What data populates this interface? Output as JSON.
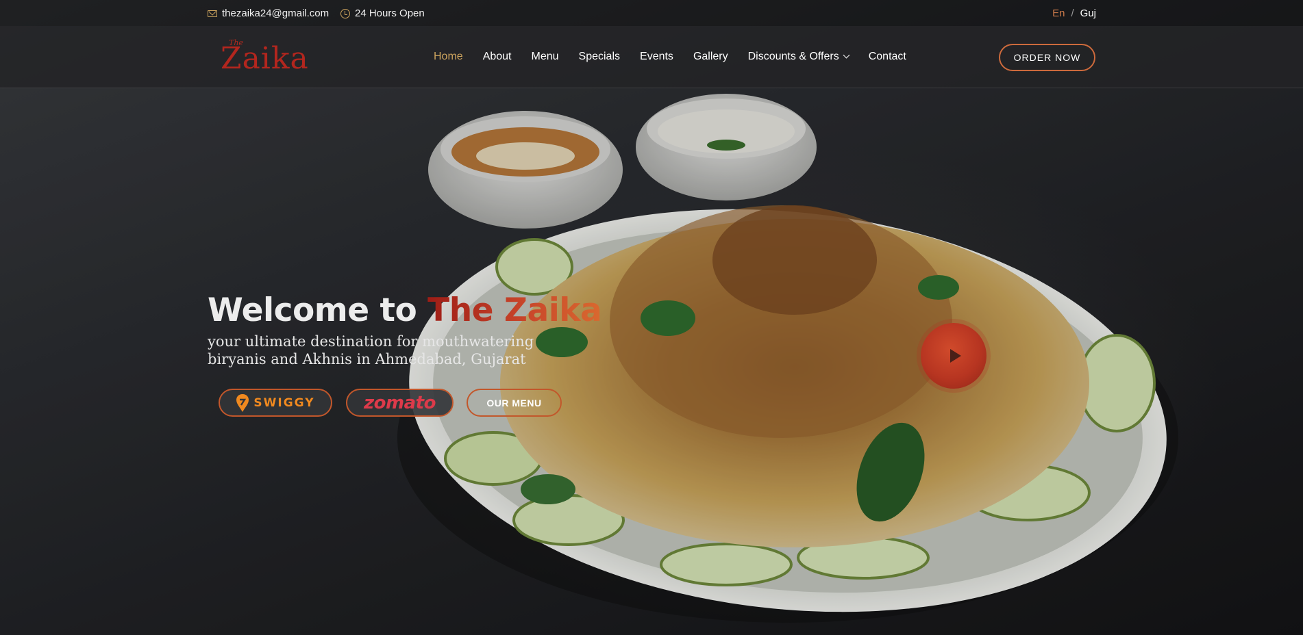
{
  "topbar": {
    "email": "thezaika24@gmail.com",
    "hours": "24 Hours Open",
    "lang_active": "En",
    "lang_separator": "/",
    "lang_other": "Guj"
  },
  "header": {
    "logo_small": "The",
    "logo_name": "Zaika",
    "nav": [
      {
        "label": "Home",
        "active": true
      },
      {
        "label": "About"
      },
      {
        "label": "Menu"
      },
      {
        "label": "Specials"
      },
      {
        "label": "Events"
      },
      {
        "label": "Gallery"
      },
      {
        "label": "Discounts & Offers",
        "dropdown": true
      },
      {
        "label": "Contact"
      }
    ],
    "order_button": "ORDER NOW"
  },
  "hero": {
    "welcome_prefix": "Welcome to ",
    "welcome_brand": "The Zaika",
    "tagline_line1": "your ultimate destination for mouthwatering",
    "tagline_line2": "biryanis and Akhnis in Ahmedabad, Gujarat",
    "swiggy_label": "SWIGGY",
    "zomato_label": "zomato",
    "menu_button": "OUR MENU",
    "play_icon": "play-icon"
  },
  "colors": {
    "accent_gold": "#cda45e",
    "brand_red": "#b3261e",
    "button_border": "#c2572b",
    "swiggy_orange": "#f0891f",
    "zomato_red": "#dd3a4a"
  }
}
